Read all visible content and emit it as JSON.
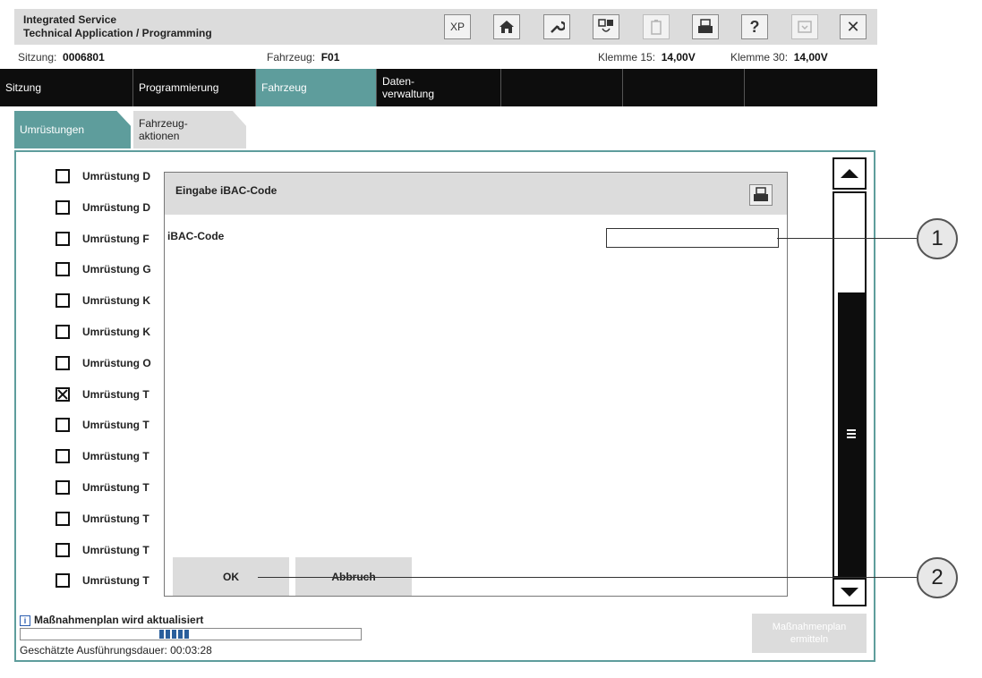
{
  "app": {
    "title_line1": "Integrated Service",
    "title_line2": "Technical Application / Programming"
  },
  "toolbar": {
    "xp_label": "XP",
    "help_label": "?",
    "close_label": "✕"
  },
  "info": {
    "session_label": "Sitzung:",
    "session_value": "0006801",
    "vehicle_label": "Fahrzeug:",
    "vehicle_value": "F01",
    "terminal15_label": "Klemme 15:",
    "terminal15_value": "14,00V",
    "terminal30_label": "Klemme 30:",
    "terminal30_value": "14,00V"
  },
  "mainnav": {
    "items": [
      {
        "label": "Sitzung"
      },
      {
        "label": "Programmierung"
      },
      {
        "label": "Fahrzeug"
      },
      {
        "label": "Daten-\nverwaltung"
      }
    ]
  },
  "subtabs": [
    {
      "label": "Umrüstungen"
    },
    {
      "label": "Fahrzeug-\naktionen"
    }
  ],
  "list": {
    "items": [
      {
        "label": "Umrüstung D",
        "checked": false
      },
      {
        "label": "Umrüstung D",
        "checked": false
      },
      {
        "label": "Umrüstung F",
        "checked": false
      },
      {
        "label": "Umrüstung G",
        "checked": false
      },
      {
        "label": "Umrüstung K",
        "checked": false
      },
      {
        "label": "Umrüstung K",
        "checked": false
      },
      {
        "label": "Umrüstung O",
        "checked": false
      },
      {
        "label": "Umrüstung T",
        "checked": true
      },
      {
        "label": "Umrüstung T",
        "checked": false
      },
      {
        "label": "Umrüstung T",
        "checked": false
      },
      {
        "label": "Umrüstung T",
        "checked": false
      },
      {
        "label": "Umrüstung T",
        "checked": false
      },
      {
        "label": "Umrüstung T",
        "checked": false
      },
      {
        "label": "Umrüstung T",
        "checked": false
      }
    ]
  },
  "dialog": {
    "title": "Eingabe iBAC-Code",
    "field_label": "iBAC-Code",
    "field_value": "",
    "ok_label": "OK",
    "cancel_label": "Abbruch"
  },
  "status": {
    "message": "Maßnahmenplan wird aktualisiert",
    "duration_label": "Geschätzte Ausführungsdauer:",
    "duration_value": "00:03:28",
    "plan_button_label": "Maßnahmenplan\nermitteln"
  },
  "callouts": {
    "one": "1",
    "two": "2"
  },
  "colors": {
    "accent": "#5e9d9c",
    "nav_bg": "#0d0d0d",
    "panel_bg": "#dcdcdc"
  }
}
